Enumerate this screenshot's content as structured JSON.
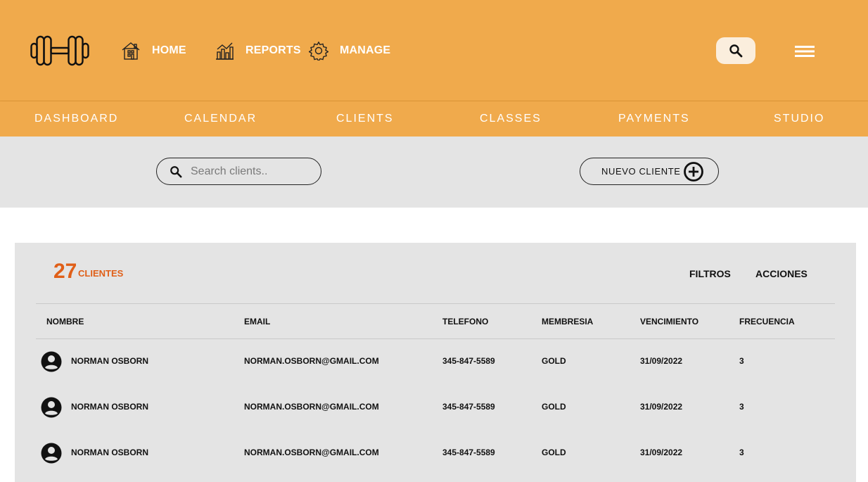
{
  "header": {
    "nav": [
      {
        "label": "HOME",
        "icon": "house-icon"
      },
      {
        "label": "REPORTS",
        "icon": "bar-chart-icon"
      },
      {
        "label": "MANAGE",
        "icon": "gear-icon"
      }
    ],
    "logo_icon": "dumbbell-icon",
    "search_icon": "search-icon",
    "menu_icon": "hamburger-menu-icon"
  },
  "tabs": [
    "DASHBOARD",
    "CALENDAR",
    "CLIENTS",
    "CLASSES",
    "PAYMENTS",
    "STUDIO"
  ],
  "toolbar": {
    "search_placeholder": "Search clients..",
    "new_client_label": "NUEVO CLIENTE"
  },
  "panel": {
    "count": "27",
    "count_label": "CLIENTES",
    "filters_label": "FILTROS",
    "actions_label": "ACCIONES",
    "columns": [
      "NOMBRE",
      "EMAIL",
      "TELEFONO",
      "MEMBRESIA",
      "VENCIMIENTO",
      "FRECUENCIA"
    ],
    "rows": [
      {
        "name": "NORMAN OSBORN",
        "email": "NORMAN.OSBORN@GMAIL.COM",
        "phone": "345-847-5589",
        "membership": "GOLD",
        "expiry": "31/09/2022",
        "frequency": "3"
      },
      {
        "name": "NORMAN OSBORN",
        "email": "NORMAN.OSBORN@GMAIL.COM",
        "phone": "345-847-5589",
        "membership": "GOLD",
        "expiry": "31/09/2022",
        "frequency": "3"
      },
      {
        "name": "NORMAN OSBORN",
        "email": "NORMAN.OSBORN@GMAIL.COM",
        "phone": "345-847-5589",
        "membership": "GOLD",
        "expiry": "31/09/2022",
        "frequency": "3"
      }
    ]
  },
  "colors": {
    "header_bg": "#f0aa4c",
    "accent_count": "#e05f18",
    "panel_bg": "#e4e4e4"
  }
}
